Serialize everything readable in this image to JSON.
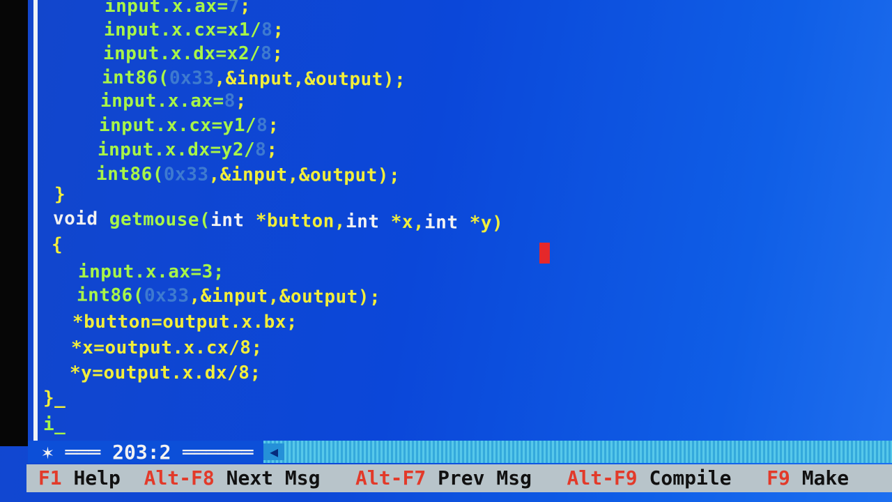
{
  "code_lines": [
    {
      "indent": "    ",
      "parts": [
        [
          "g",
          "input.x.ax="
        ],
        [
          "n",
          "7"
        ],
        [
          "y",
          ";"
        ]
      ]
    },
    {
      "indent": "    ",
      "parts": [
        [
          "g",
          "input.x.cx=x1/"
        ],
        [
          "n",
          "8"
        ],
        [
          "y",
          ";"
        ]
      ]
    },
    {
      "indent": "    ",
      "parts": [
        [
          "g",
          "input.x.dx=x2/"
        ],
        [
          "n",
          "8"
        ],
        [
          "y",
          ";"
        ]
      ]
    },
    {
      "indent": "    ",
      "parts": [
        [
          "g",
          "int86("
        ],
        [
          "n",
          "0x33"
        ],
        [
          "y",
          ",&input,&output);"
        ]
      ]
    },
    {
      "indent": "    ",
      "parts": [
        [
          "g",
          "input.x.ax="
        ],
        [
          "n",
          "8"
        ],
        [
          "y",
          ";"
        ]
      ]
    },
    {
      "indent": "    ",
      "parts": [
        [
          "g",
          "input.x.cx=y1/"
        ],
        [
          "n",
          "8"
        ],
        [
          "y",
          ";"
        ]
      ]
    },
    {
      "indent": "    ",
      "parts": [
        [
          "g",
          "input.x.dx=y2/"
        ],
        [
          "n",
          "8"
        ],
        [
          "y",
          ";"
        ]
      ]
    },
    {
      "indent": "    ",
      "parts": [
        [
          "g",
          "int86("
        ],
        [
          "n",
          "0x33"
        ],
        [
          "y",
          ",&input,&output);"
        ]
      ]
    },
    {
      "indent": "",
      "parts": [
        [
          "y",
          "}"
        ]
      ]
    },
    {
      "indent": "",
      "parts": [
        [
          "k",
          "void "
        ],
        [
          "g",
          "getmouse("
        ],
        [
          "k",
          "int "
        ],
        [
          "y",
          "*button,"
        ],
        [
          "k",
          "int "
        ],
        [
          "y",
          "*x,"
        ],
        [
          "k",
          "int "
        ],
        [
          "y",
          "*y)"
        ]
      ]
    },
    {
      "indent": "",
      "parts": [
        [
          "y",
          "{"
        ]
      ]
    },
    {
      "indent": "  ",
      "parts": [
        [
          "g",
          "input.x.ax=3;"
        ]
      ]
    },
    {
      "indent": "  ",
      "parts": [
        [
          "g",
          "int86("
        ],
        [
          "n",
          "0x33"
        ],
        [
          "y",
          ",&input,&output);"
        ]
      ]
    },
    {
      "indent": " ",
      "parts": [
        [
          "y",
          "*button=output.x.bx;"
        ]
      ]
    },
    {
      "indent": " ",
      "parts": [
        [
          "y",
          "*x=output.x.cx/8;"
        ]
      ]
    },
    {
      "indent": " ",
      "parts": [
        [
          "y",
          "*y=output.x.dx/8;"
        ]
      ]
    },
    {
      "indent": "",
      "parts": [
        [
          "y",
          "}_"
        ]
      ]
    },
    {
      "indent": "",
      "parts": [
        [
          "g",
          "i_"
        ]
      ]
    }
  ],
  "status": {
    "position": "203:2"
  },
  "function_keys": [
    {
      "key": "F1",
      "label": "Help"
    },
    {
      "key": "Alt-F8",
      "label": "Next Msg"
    },
    {
      "key": "Alt-F7",
      "label": "Prev Msg"
    },
    {
      "key": "Alt-F9",
      "label": "Compile"
    },
    {
      "key": "F9",
      "label": "Make"
    }
  ]
}
